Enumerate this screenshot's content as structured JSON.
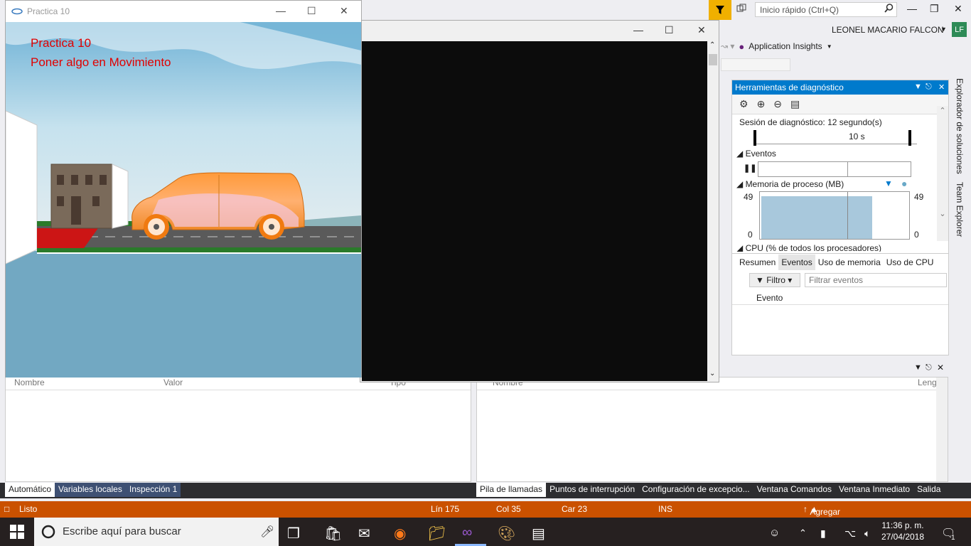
{
  "vs": {
    "quick_launch_placeholder": "Inicio rápido (Ctrl+Q)",
    "user_name": "LEONEL MACARIO FALCON",
    "user_initials": "LF",
    "app_insights": "Application Insights",
    "accent_color": "#007acc",
    "status_color": "#ca5100"
  },
  "diagnostics": {
    "title": "Herramientas de diagnóstico",
    "session": "Sesión de diagnóstico: 12 segundo(s)",
    "timeline_label": "10 s",
    "events_section": "Eventos",
    "memory_section": "Memoria de proceso (MB)",
    "mem_max_left": "49",
    "mem_min_left": "0",
    "mem_max_right": "49",
    "mem_min_right": "0",
    "cpu_section": "CPU (% de todos los procesadores)",
    "tabs": [
      "Resumen",
      "Eventos",
      "Uso de memoria",
      "Uso de CPU"
    ],
    "filter_label": "Filtro",
    "filter_placeholder": "Filtrar eventos",
    "events_col": "Evento"
  },
  "right_sidebar": {
    "tabs": [
      "Explorador de soluciones",
      "Team Explorer"
    ]
  },
  "locals_panel": {
    "columns": [
      "Nombre",
      "Valor",
      "Tipo"
    ],
    "tabs": [
      "Automático",
      "Variables locales",
      "Inspección 1"
    ]
  },
  "callstack_panel": {
    "columns": [
      "Nombre",
      "Leng"
    ],
    "tabs": [
      "Pila de llamadas",
      "Puntos de interrupción",
      "Configuración de excepcio...",
      "Ventana Comandos",
      "Ventana Inmediato",
      "Salida"
    ]
  },
  "status_bar": {
    "ready": "Listo",
    "line": "Lín 175",
    "col": "Col 35",
    "car": "Car 23",
    "mode": "INS",
    "source_control": "Agregar al control de código fuente"
  },
  "gl_window": {
    "title": "Practica 10",
    "line1": "Practica 10",
    "line2": "Poner algo en Movimiento"
  },
  "taskbar": {
    "search_placeholder": "Escribe aquí para buscar",
    "time": "11:36 p. m.",
    "date": "27/04/2018",
    "notifications": "1"
  }
}
